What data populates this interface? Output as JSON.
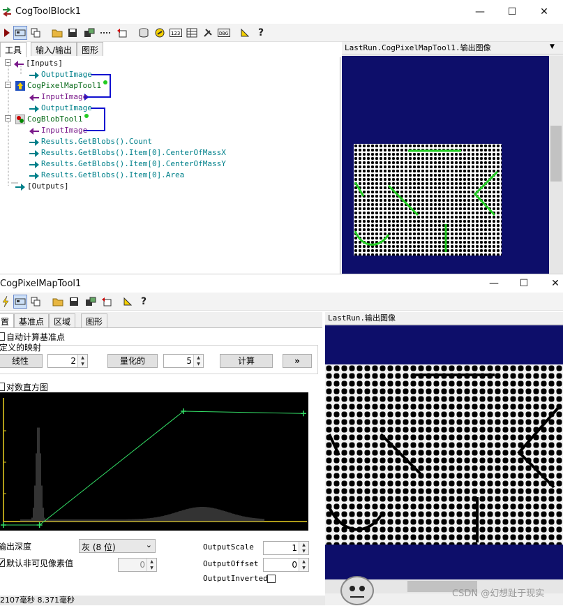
{
  "window1": {
    "title": "CogToolBlock1",
    "controls": {
      "minimize": "—",
      "maximize": "☐",
      "close": "✕"
    },
    "tabs": [
      "工具",
      "输入/输出",
      "图形"
    ],
    "tree": {
      "inputs": "[Inputs]",
      "output_image": "OutputImage",
      "pixelmap_tool": "CogPixelMapTool1",
      "input_image_1": "InputImage",
      "output_image_2": "OutputImage",
      "blob_tool": "CogBlobTool1",
      "input_image_2": "InputImage",
      "res_count": "Results.GetBlobs().Count",
      "res_cx": "Results.GetBlobs().Item[0].CenterOfMassX",
      "res_cy": "Results.GetBlobs().Item[0].CenterOfMassY",
      "res_area": "Results.GetBlobs().Item[0].Area",
      "outputs": "[Outputs]"
    },
    "image_panel_title": "LastRun.CogPixelMapTool1.输出图像"
  },
  "window2": {
    "title": "CogPixelMapTool1",
    "tabs": [
      "置",
      "基准点",
      "区域",
      "图形"
    ],
    "auto_calc_label": "自动计算基准点",
    "mapping_group": "定义的映射",
    "linear_button": "线性",
    "linear_value": "2",
    "quantized_button": "量化的",
    "quantized_value": "5",
    "compute_button": "计算",
    "more_button": "»",
    "log_histogram_label": "对数直方图",
    "output_depth_label": "输出深度",
    "output_depth_value": "灰 (8 位)",
    "default_invisible_label": "默认非可见像素值",
    "default_invisible_value": "0",
    "output_scale_label": "OutputScale",
    "output_scale_value": "1",
    "output_offset_label": "OutputOffset",
    "output_offset_value": "0",
    "output_inverted_label": "OutputInverted",
    "image_panel_title": "LastRun.输出图像",
    "status": "2107毫秒 8.371毫秒",
    "watermark": "CSDN @幻想趾于现实"
  },
  "colors": {
    "navy": "#0d0e6a",
    "teal": "#00808a",
    "purple": "#7a1a8a",
    "link_blue": "#1010d0",
    "curve_green": "#33dd66"
  },
  "histogram_curve": {
    "points": [
      [
        0,
        0
      ],
      [
        12,
        0
      ],
      [
        60,
        1.0
      ],
      [
        100,
        0.98
      ]
    ],
    "note": ""
  }
}
